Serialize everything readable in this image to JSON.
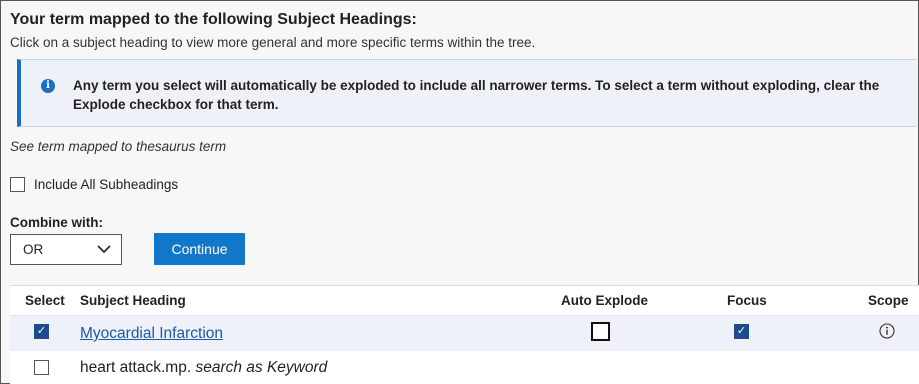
{
  "header": {
    "title": "Your term mapped to the following Subject Headings:",
    "subtitle": "Click on a subject heading to view more general and more specific terms within the tree."
  },
  "info": {
    "icon": "info-icon",
    "text": "Any term you select will automatically be exploded to include all narrower terms. To select a term without exploding, clear the Explode checkbox for that term."
  },
  "see_term": "See term mapped to thesaurus term",
  "include_subheadings": {
    "label": "Include All Subheadings",
    "checked": false
  },
  "combine": {
    "label": "Combine with:",
    "selected": "OR"
  },
  "continue_label": "Continue",
  "table": {
    "columns": {
      "select": "Select",
      "subject_heading": "Subject Heading",
      "auto_explode": "Auto Explode",
      "focus": "Focus",
      "scope": "Scope"
    },
    "rows": [
      {
        "selected": true,
        "heading": "Myocardial Infarction",
        "auto_explode": false,
        "focus": true,
        "scope_icon": "info-circle-icon"
      },
      {
        "selected": false,
        "term": "heart attack.mp.",
        "suffix": "search as Keyword"
      }
    ]
  },
  "colors": {
    "accent": "#1178c9",
    "link": "#1a5aa8",
    "checkbox_checked": "#1c4c8c",
    "info_bg": "#eef2f8"
  }
}
